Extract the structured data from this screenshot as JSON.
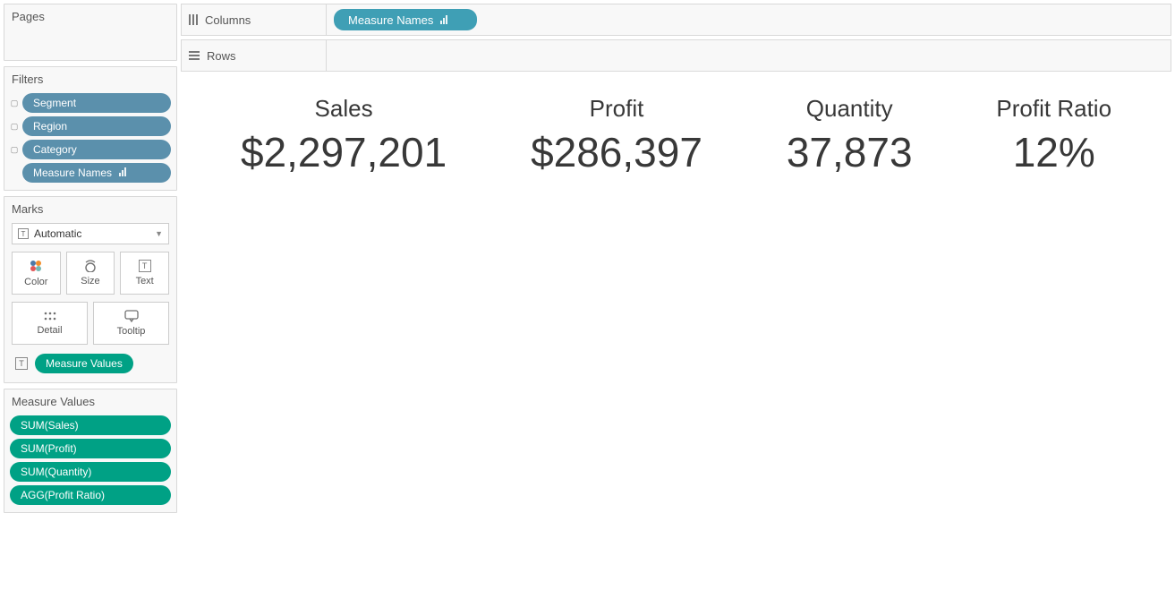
{
  "sidebar": {
    "pages_title": "Pages",
    "filters_title": "Filters",
    "filters": [
      {
        "label": "Segment",
        "color": "blue",
        "toggle": true,
        "sort": false
      },
      {
        "label": "Region",
        "color": "blue",
        "toggle": true,
        "sort": false
      },
      {
        "label": "Category",
        "color": "blue",
        "toggle": true,
        "sort": false
      },
      {
        "label": "Measure Names",
        "color": "blue",
        "toggle": false,
        "sort": true
      }
    ],
    "marks_title": "Marks",
    "marks_type": "Automatic",
    "marks_buttons": [
      "Color",
      "Size",
      "Text",
      "Detail",
      "Tooltip"
    ],
    "marks_text_pill": "Measure Values",
    "measure_values_title": "Measure Values",
    "measure_values": [
      "SUM(Sales)",
      "SUM(Profit)",
      "SUM(Quantity)",
      "AGG(Profit Ratio)"
    ]
  },
  "shelves": {
    "columns_label": "Columns",
    "rows_label": "Rows",
    "columns_pill": "Measure Names"
  },
  "metrics": [
    {
      "title": "Sales",
      "value": "$2,297,201"
    },
    {
      "title": "Profit",
      "value": "$286,397"
    },
    {
      "title": "Quantity",
      "value": "37,873"
    },
    {
      "title": "Profit Ratio",
      "value": "12%"
    }
  ]
}
